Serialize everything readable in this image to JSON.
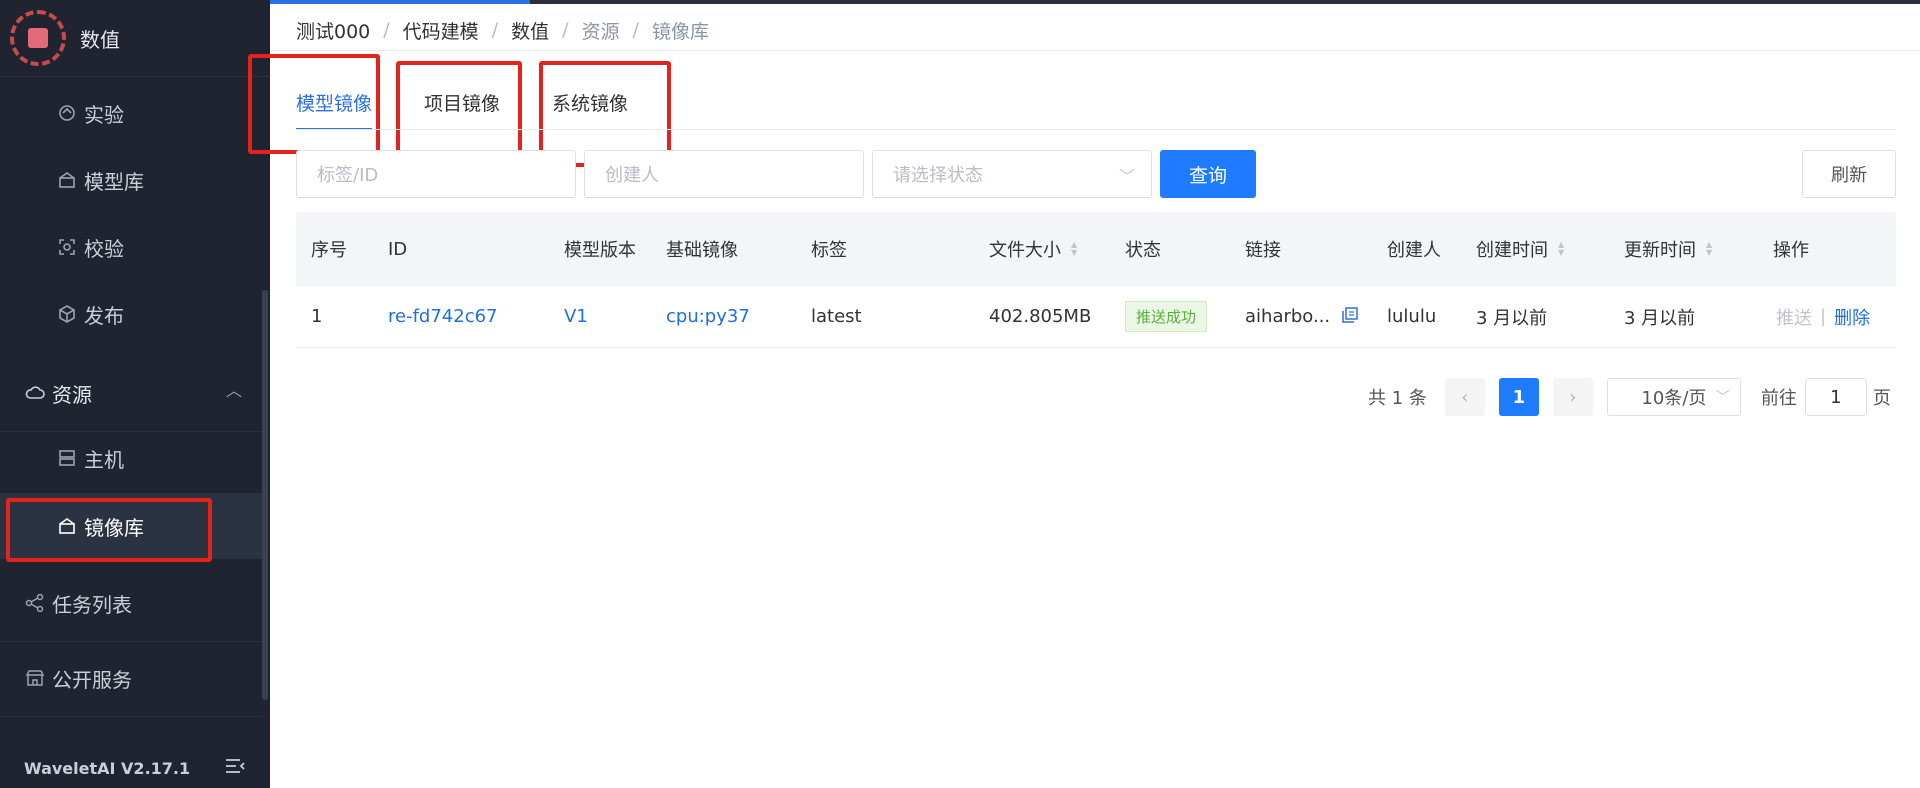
{
  "sidebar": {
    "app_title": "数值",
    "items": [
      {
        "label": "实验",
        "icon": "experiment-icon"
      },
      {
        "label": "模型库",
        "icon": "model-library-icon"
      },
      {
        "label": "校验",
        "icon": "verify-icon"
      },
      {
        "label": "发布",
        "icon": "publish-icon"
      },
      {
        "label": "资源",
        "icon": "cloud-icon"
      },
      {
        "label": "主机",
        "icon": "server-icon"
      },
      {
        "label": "镜像库",
        "icon": "image-library-icon"
      },
      {
        "label": "任务列表",
        "icon": "task-icon"
      },
      {
        "label": "公开服务",
        "icon": "store-icon"
      }
    ],
    "version": "WaveletAI V2.17.1"
  },
  "breadcrumb": [
    "测试000",
    "代码建模",
    "数值",
    "资源",
    "镜像库"
  ],
  "tabs": [
    "模型镜像",
    "项目镜像",
    "系统镜像"
  ],
  "filters": {
    "tag_placeholder": "标签/ID",
    "creator_placeholder": "创建人",
    "status_placeholder": "请选择状态",
    "query_label": "查询",
    "refresh_label": "刷新"
  },
  "table": {
    "columns": [
      "序号",
      "ID",
      "模型版本",
      "基础镜像",
      "标签",
      "文件大小",
      "状态",
      "链接",
      "创建人",
      "创建时间",
      "更新时间",
      "操作"
    ],
    "rows": [
      {
        "index": "1",
        "id": "re-fd742c67",
        "version": "V1",
        "base_image": "cpu:py37",
        "tag": "latest",
        "size": "402.805MB",
        "status": "推送成功",
        "link": "aiharbo...",
        "creator": "lululu",
        "created": "3 月以前",
        "updated": "3 月以前",
        "op_push": "推送",
        "op_delete": "删除"
      }
    ]
  },
  "pagination": {
    "total_label": "共 1 条",
    "current_page": "1",
    "page_size": "10条/页",
    "goto_label": "前往",
    "goto_value": "1",
    "page_suffix": "页"
  },
  "colors": {
    "sidebar_bg": "#1f2430",
    "accent": "#1f7bff",
    "highlight_box": "#e3231c",
    "success": "#5cae3e"
  }
}
